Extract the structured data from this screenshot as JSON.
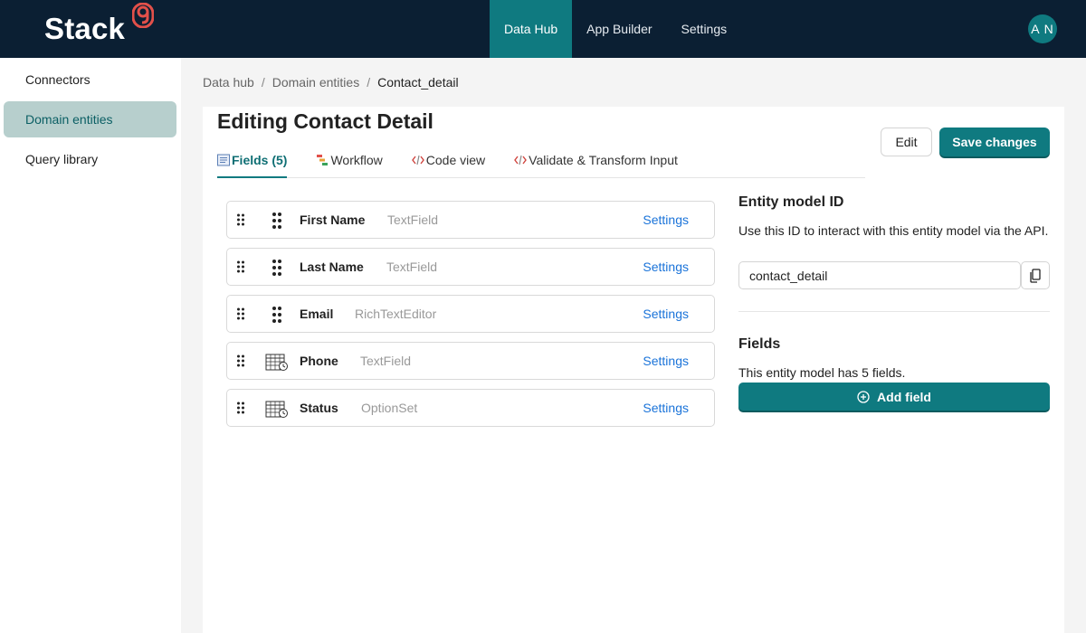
{
  "header": {
    "brand": "Stack",
    "brand_badge": "9",
    "nav": [
      {
        "label": "Data Hub",
        "active": true
      },
      {
        "label": "App Builder",
        "active": false
      },
      {
        "label": "Settings",
        "active": false
      }
    ],
    "avatar": "A N"
  },
  "sidebar": {
    "items": [
      {
        "label": "Connectors",
        "active": false
      },
      {
        "label": "Domain entities",
        "active": true
      },
      {
        "label": "Query library",
        "active": false
      }
    ]
  },
  "breadcrumb": [
    "Data hub",
    "/",
    "Domain entities",
    "/",
    "Contact_detail"
  ],
  "page": {
    "title": "Editing Contact Detail",
    "edit_label": "Edit",
    "save_label": "Save changes",
    "tabs": [
      {
        "label": "Fields (5)",
        "icon": "list-icon",
        "active": true
      },
      {
        "label": "Workflow",
        "icon": "workflow-icon",
        "active": false
      },
      {
        "label": "Code view",
        "icon": "code-icon",
        "active": false
      },
      {
        "label": "Validate & Transform Input",
        "icon": "code-icon",
        "active": false
      }
    ]
  },
  "fields": [
    {
      "name": "First Name",
      "type": "TextField",
      "icon": "drag-dots-icon",
      "settings": "Settings"
    },
    {
      "name": "Last Name",
      "type": "TextField",
      "icon": "drag-dots-icon",
      "settings": "Settings"
    },
    {
      "name": "Email",
      "type": "RichTextEditor",
      "icon": "drag-dots-icon",
      "settings": "Settings"
    },
    {
      "name": "Phone",
      "type": "TextField",
      "icon": "calendar-clock-icon",
      "settings": "Settings"
    },
    {
      "name": "Status",
      "type": "OptionSet",
      "icon": "calendar-clock-icon",
      "settings": "Settings"
    }
  ],
  "entity": {
    "heading": "Entity model ID",
    "description": "Use this ID to interact with this entity model via the API.",
    "id_value": "contact_detail"
  },
  "fields_panel": {
    "heading": "Fields",
    "description": "This entity model has 5 fields.",
    "add_label": "Add field"
  },
  "colors": {
    "header_bg": "#0b1f33",
    "accent": "#0f7a80",
    "sidebar_active": "#b7cfcd",
    "link": "#1a73d9"
  }
}
